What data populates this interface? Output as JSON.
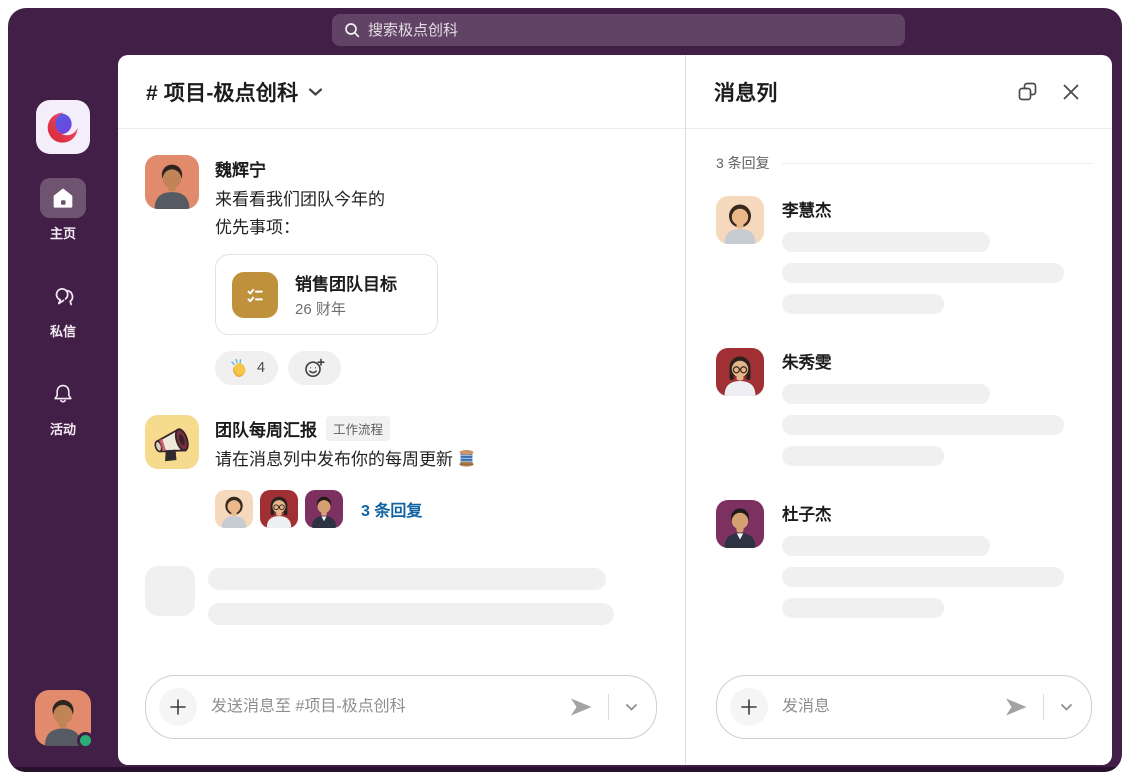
{
  "topbar": {
    "search_placeholder": "搜索极点创科"
  },
  "sidebar": {
    "items": [
      {
        "id": "home",
        "label": "主页",
        "active": true
      },
      {
        "id": "dms",
        "label": "私信",
        "active": false
      },
      {
        "id": "activity",
        "label": "活动",
        "active": false
      }
    ]
  },
  "channel": {
    "title": "# 项目-极点创科",
    "messages": [
      {
        "author": "魏辉宁",
        "text": "来看看我们团队今年的\n优先事项：",
        "card": {
          "title": "销售团队目标",
          "subtitle": "26 财年"
        },
        "reactions": [
          {
            "emoji": "👏",
            "name": "clap",
            "count": "4"
          }
        ]
      },
      {
        "author": "团队每周汇报",
        "badge": "工作流程",
        "text": "请在消息列中发布你的每周更新",
        "trailing_emoji": "🧵",
        "thread": {
          "reply_count_label": "3 条回复",
          "participants": [
            "李慧杰",
            "朱秀雯",
            "杜子杰"
          ]
        }
      }
    ],
    "composer_placeholder": "发送消息至 #项目-极点创科"
  },
  "thread_panel": {
    "title": "消息列",
    "reply_count_label": "3 条回复",
    "replies": [
      {
        "author": "李慧杰"
      },
      {
        "author": "朱秀雯"
      },
      {
        "author": "杜子杰"
      }
    ],
    "composer_placeholder": "发消息"
  },
  "icons": {
    "search": "magnifier",
    "home": "house",
    "dms": "chat-bubble",
    "activity": "bell",
    "popout": "open-in-new-window",
    "close": "x",
    "plus": "+",
    "send": "paper-plane",
    "chevron_down": "v",
    "add_reaction": "smiley-plus",
    "clap": "👏",
    "thread_spool": "🧵",
    "checklist": "checklist-card",
    "workflow_bot": "megaphone"
  },
  "colors": {
    "window_purple": "#421f46",
    "link_blue": "#1264a3",
    "card_gold": "#c0913c",
    "presence_green": "#2bac76",
    "skeleton_gray": "#f0f0f1"
  }
}
